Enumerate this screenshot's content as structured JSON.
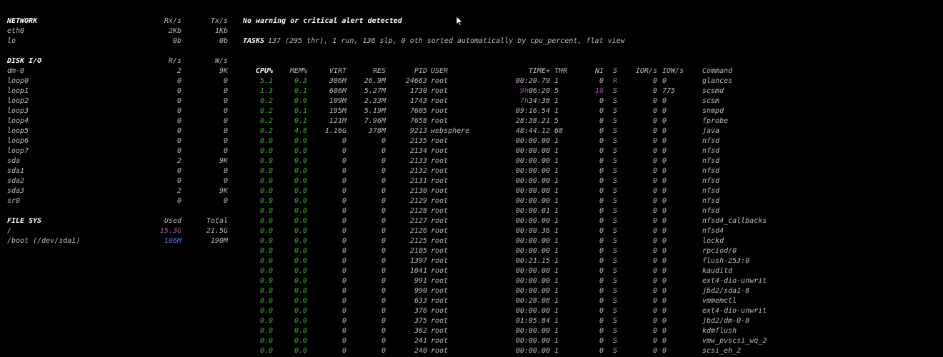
{
  "network": {
    "title": "NETWORK",
    "rx_header": "Rx/s",
    "tx_header": "Tx/s",
    "rows": [
      {
        "name": "eth0",
        "rx": "2Kb",
        "tx": "1Kb"
      },
      {
        "name": "lo",
        "rx": "0b",
        "tx": "0b"
      }
    ]
  },
  "disk_io": {
    "title": "DISK I/O",
    "r_header": "R/s",
    "w_header": "W/s",
    "rows": [
      {
        "name": "dm-0",
        "r": "2",
        "w": "9K"
      },
      {
        "name": "loop0",
        "r": "0",
        "w": "0"
      },
      {
        "name": "loop1",
        "r": "0",
        "w": "0"
      },
      {
        "name": "loop2",
        "r": "0",
        "w": "0"
      },
      {
        "name": "loop3",
        "r": "0",
        "w": "0"
      },
      {
        "name": "loop4",
        "r": "0",
        "w": "0"
      },
      {
        "name": "loop5",
        "r": "0",
        "w": "0"
      },
      {
        "name": "loop6",
        "r": "0",
        "w": "0"
      },
      {
        "name": "loop7",
        "r": "0",
        "w": "0"
      },
      {
        "name": "sda",
        "r": "2",
        "w": "9K"
      },
      {
        "name": "sda1",
        "r": "0",
        "w": "0"
      },
      {
        "name": "sda2",
        "r": "0",
        "w": "0"
      },
      {
        "name": "sda3",
        "r": "2",
        "w": "9K"
      },
      {
        "name": "sr0",
        "r": "0",
        "w": "0"
      }
    ]
  },
  "filesys": {
    "title": "FILE SYS",
    "used_header": "Used",
    "total_header": "Total",
    "rows": [
      {
        "name": "/",
        "used": "15.3G",
        "total": "21.5G",
        "used_color": "purple"
      },
      {
        "name": "/boot (/dev/sda1)",
        "used": "106M",
        "total": "190M",
        "used_color": "blue"
      }
    ]
  },
  "alert": "No warning or critical alert detected",
  "tasks": {
    "label": "TASKS",
    "summary": "137 (295 thr), 1 run, 136 slp, 0 oth sorted automatically by cpu_percent, flat view"
  },
  "process_table": {
    "headers": {
      "cpu": "CPU%",
      "mem": "MEM%",
      "virt": "VIRT",
      "res": "RES",
      "pid": "PID",
      "user": "USER",
      "time": "TIME+",
      "thr": "THR",
      "ni": "NI",
      "s": "S",
      "ior": "IOR/s",
      "iow": "IOW/s",
      "command": "Command"
    },
    "rows": [
      {
        "cpu": "5.1",
        "mem": "0.3",
        "virt": "306M",
        "res": "26.9M",
        "pid": "24663",
        "user": "root",
        "time": "00:20.79",
        "time_pre": "",
        "thr": "1",
        "ni": "0",
        "s": "R",
        "ior": "0",
        "iow": "0",
        "command": "glances"
      },
      {
        "cpu": "1.3",
        "mem": "0.1",
        "virt": "606M",
        "res": "5.27M",
        "pid": "1730",
        "user": "root",
        "time": "06:20",
        "time_pre": "9h",
        "thr": "5",
        "ni": "10",
        "s": "S",
        "ior": "0",
        "iow": "775",
        "command": "scsmd"
      },
      {
        "cpu": "0.2",
        "mem": "0.0",
        "virt": "109M",
        "res": "2.33M",
        "pid": "1743",
        "user": "root",
        "time": "34:38",
        "time_pre": "7h",
        "thr": "1",
        "ni": "0",
        "s": "S",
        "ior": "0",
        "iow": "0",
        "command": "scsm"
      },
      {
        "cpu": "0.2",
        "mem": "0.1",
        "virt": "195M",
        "res": "5.19M",
        "pid": "7605",
        "user": "root",
        "time": "09:16.54",
        "time_pre": "",
        "thr": "1",
        "ni": "0",
        "s": "S",
        "ior": "0",
        "iow": "0",
        "command": "snmpd"
      },
      {
        "cpu": "0.2",
        "mem": "0.1",
        "virt": "121M",
        "res": "7.96M",
        "pid": "7658",
        "user": "root",
        "time": "28:38.21",
        "time_pre": "",
        "thr": "5",
        "ni": "0",
        "s": "S",
        "ior": "0",
        "iow": "0",
        "command": "fprobe"
      },
      {
        "cpu": "0.2",
        "mem": "4.8",
        "virt": "1.16G",
        "res": "378M",
        "pid": "9213",
        "user": "websphere",
        "time": "48:44.12",
        "time_pre": "",
        "thr": "68",
        "ni": "0",
        "s": "S",
        "ior": "0",
        "iow": "0",
        "command": "java"
      },
      {
        "cpu": "0.0",
        "mem": "0.0",
        "virt": "0",
        "res": "0",
        "pid": "2135",
        "user": "root",
        "time": "00:00.00",
        "time_pre": "",
        "thr": "1",
        "ni": "0",
        "s": "S",
        "ior": "0",
        "iow": "0",
        "command": "nfsd"
      },
      {
        "cpu": "0.0",
        "mem": "0.0",
        "virt": "0",
        "res": "0",
        "pid": "2134",
        "user": "root",
        "time": "00:00.00",
        "time_pre": "",
        "thr": "1",
        "ni": "0",
        "s": "S",
        "ior": "0",
        "iow": "0",
        "command": "nfsd"
      },
      {
        "cpu": "0.0",
        "mem": "0.0",
        "virt": "0",
        "res": "0",
        "pid": "2133",
        "user": "root",
        "time": "00:00.00",
        "time_pre": "",
        "thr": "1",
        "ni": "0",
        "s": "S",
        "ior": "0",
        "iow": "0",
        "command": "nfsd"
      },
      {
        "cpu": "0.0",
        "mem": "0.0",
        "virt": "0",
        "res": "0",
        "pid": "2132",
        "user": "root",
        "time": "00:00.00",
        "time_pre": "",
        "thr": "1",
        "ni": "0",
        "s": "S",
        "ior": "0",
        "iow": "0",
        "command": "nfsd"
      },
      {
        "cpu": "0.0",
        "mem": "0.0",
        "virt": "0",
        "res": "0",
        "pid": "2131",
        "user": "root",
        "time": "00:00.00",
        "time_pre": "",
        "thr": "1",
        "ni": "0",
        "s": "S",
        "ior": "0",
        "iow": "0",
        "command": "nfsd"
      },
      {
        "cpu": "0.0",
        "mem": "0.0",
        "virt": "0",
        "res": "0",
        "pid": "2130",
        "user": "root",
        "time": "00:00.00",
        "time_pre": "",
        "thr": "1",
        "ni": "0",
        "s": "S",
        "ior": "0",
        "iow": "0",
        "command": "nfsd"
      },
      {
        "cpu": "0.0",
        "mem": "0.0",
        "virt": "0",
        "res": "0",
        "pid": "2129",
        "user": "root",
        "time": "00:00.00",
        "time_pre": "",
        "thr": "1",
        "ni": "0",
        "s": "S",
        "ior": "0",
        "iow": "0",
        "command": "nfsd"
      },
      {
        "cpu": "0.0",
        "mem": "0.0",
        "virt": "0",
        "res": "0",
        "pid": "2128",
        "user": "root",
        "time": "00:00.01",
        "time_pre": "",
        "thr": "1",
        "ni": "0",
        "s": "S",
        "ior": "0",
        "iow": "0",
        "command": "nfsd"
      },
      {
        "cpu": "0.0",
        "mem": "0.0",
        "virt": "0",
        "res": "0",
        "pid": "2127",
        "user": "root",
        "time": "00:00.00",
        "time_pre": "",
        "thr": "1",
        "ni": "0",
        "s": "S",
        "ior": "0",
        "iow": "0",
        "command": "nfsd4_callbacks"
      },
      {
        "cpu": "0.0",
        "mem": "0.0",
        "virt": "0",
        "res": "0",
        "pid": "2126",
        "user": "root",
        "time": "00:00.36",
        "time_pre": "",
        "thr": "1",
        "ni": "0",
        "s": "S",
        "ior": "0",
        "iow": "0",
        "command": "nfsd4"
      },
      {
        "cpu": "0.0",
        "mem": "0.0",
        "virt": "0",
        "res": "0",
        "pid": "2125",
        "user": "root",
        "time": "00:00.00",
        "time_pre": "",
        "thr": "1",
        "ni": "0",
        "s": "S",
        "ior": "0",
        "iow": "0",
        "command": "lockd"
      },
      {
        "cpu": "0.0",
        "mem": "0.0",
        "virt": "0",
        "res": "0",
        "pid": "2105",
        "user": "root",
        "time": "00:00.00",
        "time_pre": "",
        "thr": "1",
        "ni": "0",
        "s": "S",
        "ior": "0",
        "iow": "0",
        "command": "rpciod/0"
      },
      {
        "cpu": "0.0",
        "mem": "0.0",
        "virt": "0",
        "res": "0",
        "pid": "1397",
        "user": "root",
        "time": "00:21.15",
        "time_pre": "",
        "thr": "1",
        "ni": "0",
        "s": "S",
        "ior": "0",
        "iow": "0",
        "command": "flush-253:0"
      },
      {
        "cpu": "0.0",
        "mem": "0.0",
        "virt": "0",
        "res": "0",
        "pid": "1041",
        "user": "root",
        "time": "00:00.00",
        "time_pre": "",
        "thr": "1",
        "ni": "0",
        "s": "S",
        "ior": "0",
        "iow": "0",
        "command": "kauditd"
      },
      {
        "cpu": "0.0",
        "mem": "0.0",
        "virt": "0",
        "res": "0",
        "pid": "991",
        "user": "root",
        "time": "00:00.00",
        "time_pre": "",
        "thr": "1",
        "ni": "0",
        "s": "S",
        "ior": "0",
        "iow": "0",
        "command": "ext4-dio-unwrit"
      },
      {
        "cpu": "0.0",
        "mem": "0.0",
        "virt": "0",
        "res": "0",
        "pid": "990",
        "user": "root",
        "time": "00:00.00",
        "time_pre": "",
        "thr": "1",
        "ni": "0",
        "s": "S",
        "ior": "0",
        "iow": "0",
        "command": "jbd2/sda1-8"
      },
      {
        "cpu": "0.0",
        "mem": "0.0",
        "virt": "0",
        "res": "0",
        "pid": "633",
        "user": "root",
        "time": "00:28.08",
        "time_pre": "",
        "thr": "1",
        "ni": "0",
        "s": "S",
        "ior": "0",
        "iow": "0",
        "command": "vmmemctl"
      },
      {
        "cpu": "0.0",
        "mem": "0.0",
        "virt": "0",
        "res": "0",
        "pid": "376",
        "user": "root",
        "time": "00:00.00",
        "time_pre": "",
        "thr": "1",
        "ni": "0",
        "s": "S",
        "ior": "0",
        "iow": "0",
        "command": "ext4-dio-unwrit"
      },
      {
        "cpu": "0.0",
        "mem": "0.0",
        "virt": "0",
        "res": "0",
        "pid": "375",
        "user": "root",
        "time": "01:05.84",
        "time_pre": "",
        "thr": "1",
        "ni": "0",
        "s": "S",
        "ior": "0",
        "iow": "0",
        "command": "jbd2/dm-0-8"
      },
      {
        "cpu": "0.0",
        "mem": "0.0",
        "virt": "0",
        "res": "0",
        "pid": "362",
        "user": "root",
        "time": "00:00.00",
        "time_pre": "",
        "thr": "1",
        "ni": "0",
        "s": "S",
        "ior": "0",
        "iow": "0",
        "command": "kdmflush"
      },
      {
        "cpu": "0.0",
        "mem": "0.0",
        "virt": "0",
        "res": "0",
        "pid": "241",
        "user": "root",
        "time": "00:00.00",
        "time_pre": "",
        "thr": "1",
        "ni": "0",
        "s": "S",
        "ior": "0",
        "iow": "0",
        "command": "vmw_pvscsi_wq_2"
      },
      {
        "cpu": "0.0",
        "mem": "0.0",
        "virt": "0",
        "res": "0",
        "pid": "240",
        "user": "root",
        "time": "00:00.00",
        "time_pre": "",
        "thr": "1",
        "ni": "0",
        "s": "S",
        "ior": "0",
        "iow": "0",
        "command": "scsi_eh_2"
      }
    ]
  },
  "colors": {
    "background": "#000000",
    "text": "#cfcfcf",
    "header": "#ffffff",
    "green": "#4caa3a",
    "purple": "#9a5aa6",
    "blue": "#4f7fe0"
  },
  "icons": {
    "cursor": "mouse-pointer-icon"
  }
}
